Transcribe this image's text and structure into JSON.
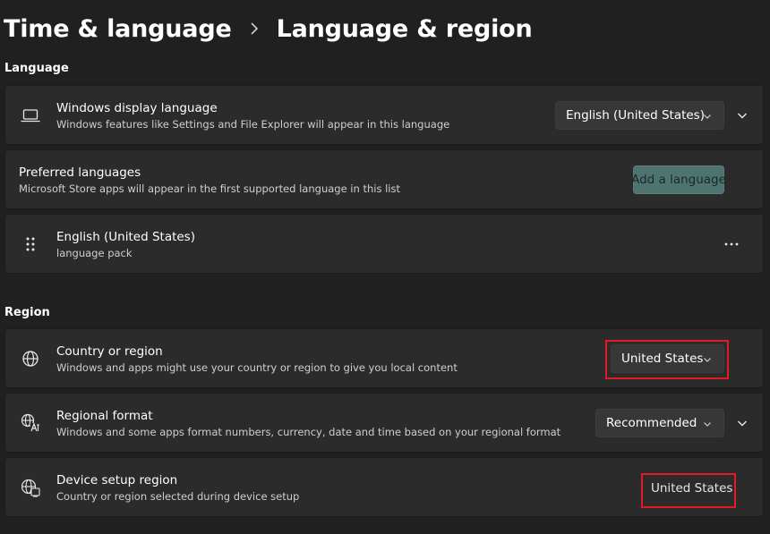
{
  "breadcrumb": {
    "parent": "Time & language",
    "current": "Language & region"
  },
  "sections": {
    "language": "Language",
    "region": "Region"
  },
  "display_language": {
    "title": "Windows display language",
    "description": "Windows features like Settings and File Explorer will appear in this language",
    "value": "English (United States)"
  },
  "preferred_languages": {
    "title": "Preferred languages",
    "description": "Microsoft Store apps will appear in the first supported language in this list",
    "button": "Add a language"
  },
  "language_item": {
    "title": "English (United States)",
    "description": "language pack"
  },
  "country_region": {
    "title": "Country or region",
    "description": "Windows and apps might use your country or region to give you local content",
    "value": "United States"
  },
  "regional_format": {
    "title": "Regional format",
    "description": "Windows and some apps format numbers, currency, date and time based on your regional format",
    "value": "Recommended"
  },
  "device_setup_region": {
    "title": "Device setup region",
    "description": "Country or region selected during device setup",
    "value": "United States"
  },
  "colors": {
    "accent": "#4d7470",
    "highlight": "#e21b23",
    "background": "#202020",
    "card": "#2b2b2b"
  },
  "icons": [
    "laptop-icon",
    "gripper-icon",
    "globe-icon",
    "regional-format-icon",
    "device-globe-icon",
    "chevron-down-icon",
    "more-icon"
  ]
}
